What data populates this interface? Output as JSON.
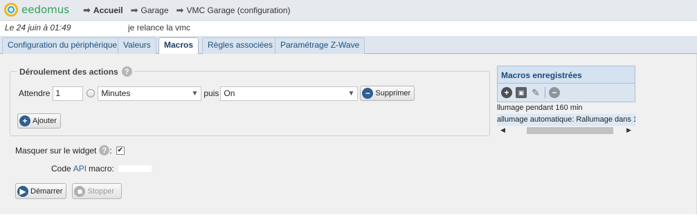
{
  "brand": {
    "name": "eedomus"
  },
  "breadcrumb": [
    "Accueil",
    "Garage",
    "VMC Garage (configuration)"
  ],
  "info": {
    "date": "Le 24 juin à 01:49",
    "message": "je relance la vmc"
  },
  "tabs": [
    {
      "label": "Configuration du périphérique",
      "active": false
    },
    {
      "label": "Valeurs",
      "active": false
    },
    {
      "label": "Macros",
      "active": true
    },
    {
      "label": "Règles associées",
      "active": false
    },
    {
      "label": "Paramétrage Z-Wave",
      "active": false
    }
  ],
  "actions_section": {
    "legend": "Déroulement des actions",
    "help": "?",
    "wait_label": "Attendre",
    "wait_value": "1",
    "unit_selected": "Minutes",
    "then_label": "puis",
    "then_selected": "On",
    "delete_label": "Supprimer",
    "add_label": "Ajouter"
  },
  "mask": {
    "label": "Masquer sur le widget",
    "colon": ":",
    "checked_mark": "✔"
  },
  "api": {
    "prefix": "Code",
    "api_word": "API",
    "suffix": "macro:"
  },
  "buttons": {
    "start": "Démarrer",
    "stop": "Stopper"
  },
  "macros_panel": {
    "title": "Macros enregistrées",
    "tools": [
      "add-icon",
      "save-icon",
      "edit-icon",
      "remove-icon"
    ],
    "items": [
      {
        "label": "llumage pendant 160 min",
        "selected": false
      },
      {
        "label": "allumage automatique: Rallumage dans 1",
        "selected": true
      }
    ]
  },
  "colors": {
    "accent": "#1d4a7a",
    "brand_ring": "#f2b619",
    "brand_text": "#2aa05a"
  }
}
